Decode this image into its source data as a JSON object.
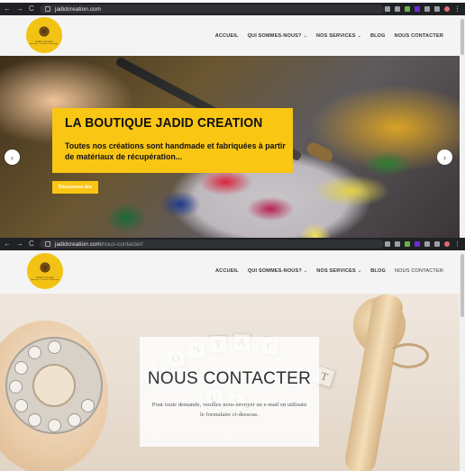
{
  "window1": {
    "url_host": "jadidcreation.com",
    "url_path": ""
  },
  "window2": {
    "url_host": "jadidcreation.com",
    "url_path": "/nous-contacter/"
  },
  "nav_glyphs": {
    "back": "←",
    "forward": "→",
    "reload": "C"
  },
  "logo": {
    "brand": "Jadid Création",
    "tagline": "Artisanat · Création · Recyclage"
  },
  "menu": {
    "items": [
      "ACCUEIL",
      "QUI SOMMES-NOUS?",
      "NOS SERVICES",
      "BLOG",
      "NOUS CONTACTER"
    ],
    "chevron": "⌄"
  },
  "hero1": {
    "title": "LA BOUTIQUE JADID CREATION",
    "description": "Toutes nos créations sont handmade et fabriquées à partir de matériaux de récupération...",
    "cta": "Découvrez-les",
    "prev_arrow": "‹",
    "next_arrow": "›"
  },
  "hero2": {
    "title": "NOUS CONTACTER",
    "text": "Pour toute demande, veuillez nous envoyer un e-mail en utilisant le formulaire ci-dessous.",
    "tiles": [
      "O",
      "N",
      "T",
      "A",
      "C",
      "T",
      "C",
      "U",
      "S"
    ]
  },
  "colors": {
    "accent": "#fac614",
    "chrome": "#202124",
    "header_bg": "#f4f4f4"
  }
}
